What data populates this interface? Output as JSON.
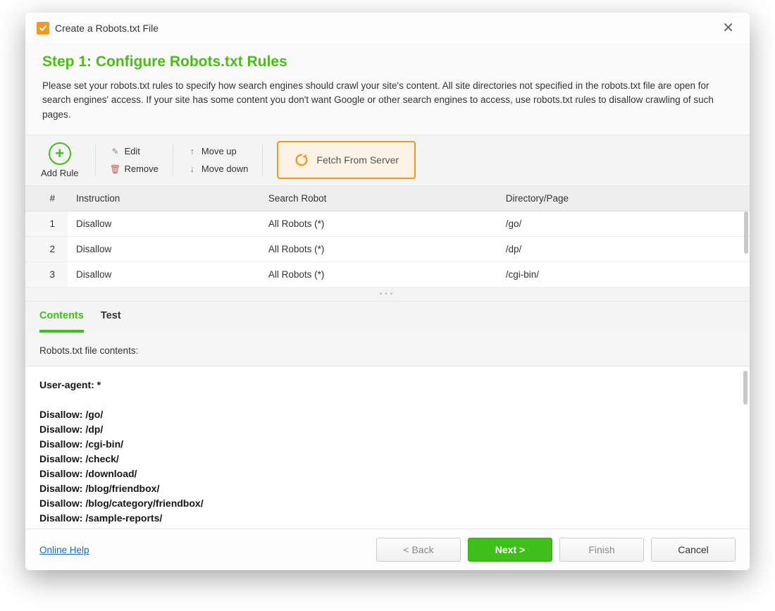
{
  "title": "Create a Robots.txt File",
  "step": {
    "heading": "Step 1: Configure Robots.txt Rules",
    "description": "Please set your robots.txt rules to specify how search engines should crawl your site's content. All site directories not specified in the robots.txt file are open for search engines' access. If your site has some content you don't want Google or other search engines to access, use robots.txt rules to disallow crawling of such pages."
  },
  "toolbar": {
    "add_rule": "Add Rule",
    "edit": "Edit",
    "remove": "Remove",
    "move_up": "Move up",
    "move_down": "Move down",
    "fetch": "Fetch From Server"
  },
  "columns": {
    "num": "#",
    "instruction": "Instruction",
    "robot": "Search Robot",
    "path": "Directory/Page"
  },
  "rules": [
    {
      "n": "1",
      "instruction": "Disallow",
      "robot": "All Robots (*)",
      "path": "/go/"
    },
    {
      "n": "2",
      "instruction": "Disallow",
      "robot": "All Robots (*)",
      "path": "/dp/"
    },
    {
      "n": "3",
      "instruction": "Disallow",
      "robot": "All Robots (*)",
      "path": "/cgi-bin/"
    }
  ],
  "tabs": {
    "contents": "Contents",
    "test": "Test"
  },
  "contents_label": "Robots.txt file contents:",
  "preview_lines": [
    "User-agent: *",
    "",
    "Disallow: /go/",
    "Disallow: /dp/",
    "Disallow: /cgi-bin/",
    "Disallow: /check/",
    "Disallow: /download/",
    "Disallow: /blog/friendbox/",
    "Disallow: /blog/category/friendbox/",
    "Disallow: /sample-reports/"
  ],
  "footer": {
    "help": "Online Help",
    "back": "< Back",
    "next": "Next >",
    "finish": "Finish",
    "cancel": "Cancel"
  }
}
